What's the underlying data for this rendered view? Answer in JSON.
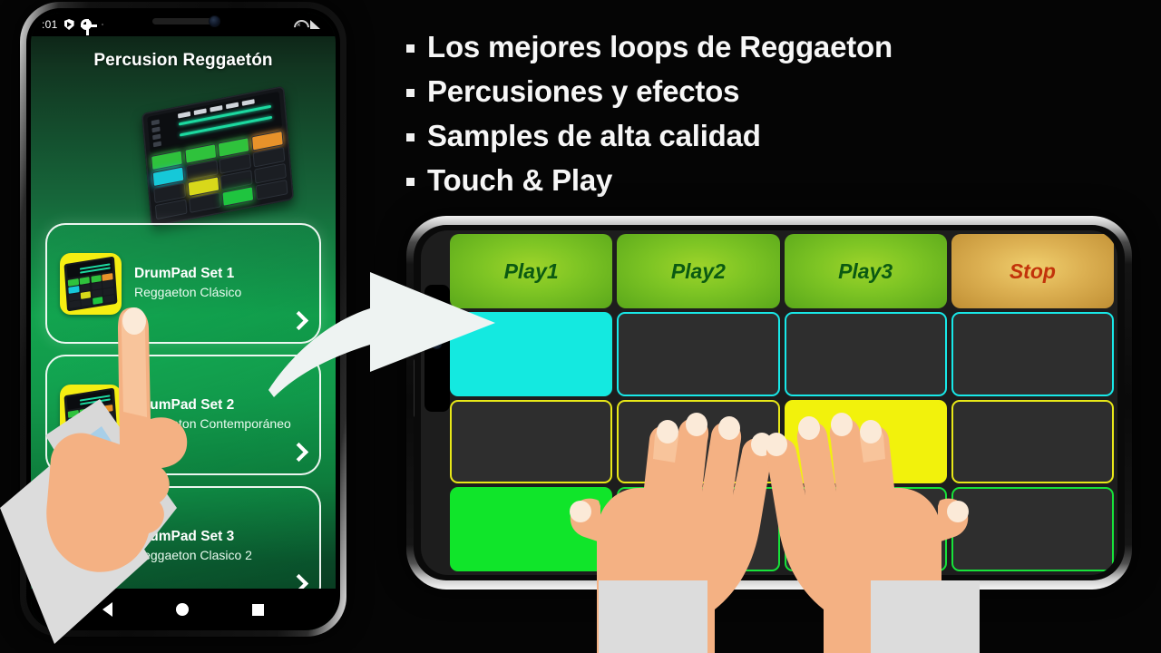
{
  "phone_portrait": {
    "status_bar": {
      "time": ":01",
      "icons": [
        "shield-icon",
        "gear-icon",
        "wifi-off-icon",
        "signal-icon"
      ],
      "tick": "⌐"
    },
    "app_title": "Percusion Reggaetón",
    "hero_image": "drum-machine-illustration",
    "cards": [
      {
        "title": "DrumPad Set 1",
        "subtitle": "Reggaeton Clásico",
        "chevron": "chevron-right-icon",
        "thumb": "drumpad-thumbnail"
      },
      {
        "title": "DrumPad Set 2",
        "subtitle": "Reggaeton Contemporáneo",
        "chevron": "chevron-right-icon",
        "thumb": "drumpad-thumbnail"
      },
      {
        "title": "DrumPad Set 3",
        "subtitle": "Reggaeton Clasico 2",
        "chevron": "chevron-right-icon",
        "thumb": "drumpad-thumbnail"
      }
    ],
    "nav_bar": {
      "back": "back-triangle-icon",
      "home": "home-circle-icon",
      "recents": "recents-square-icon"
    }
  },
  "bullets": [
    {
      "text": "Los mejores loops de Reggaeton"
    },
    {
      "text": "Percusiones y efectos"
    },
    {
      "text": "Samples de alta calidad"
    },
    {
      "text": "Touch & Play"
    }
  ],
  "phone_landscape": {
    "transport_buttons": [
      {
        "label": "Play1",
        "style": "green"
      },
      {
        "label": "Play2",
        "style": "green"
      },
      {
        "label": "Play3",
        "style": "green"
      },
      {
        "label": "Stop",
        "style": "stop"
      }
    ],
    "pad_grid": {
      "rows": 3,
      "columns": 4,
      "row_colors": [
        "#18e8e8",
        "#e8e818",
        "#17e23a"
      ],
      "pads": [
        [
          {
            "lit": true,
            "color": "#14e9e0"
          },
          {
            "lit": false
          },
          {
            "lit": false
          },
          {
            "lit": false
          }
        ],
        [
          {
            "lit": false
          },
          {
            "lit": false
          },
          {
            "lit": true,
            "color": "#f2f20c"
          },
          {
            "lit": false
          }
        ],
        [
          {
            "lit": true,
            "color": "#10e52a"
          },
          {
            "lit": false
          },
          {
            "lit": false
          },
          {
            "lit": false
          }
        ]
      ]
    }
  },
  "decorations": {
    "flow_arrow": "curved-right-arrow",
    "pointing_hand": "pointing-hand-illustration",
    "playing_hands": "two-hands-illustration"
  },
  "colors": {
    "background": "#050505",
    "screen_green": "#13a34e",
    "accent_yellow": "#f5ee12",
    "play_green": "#7ec524",
    "stop_amber": "#dcb052",
    "stop_text": "#c2330a"
  }
}
